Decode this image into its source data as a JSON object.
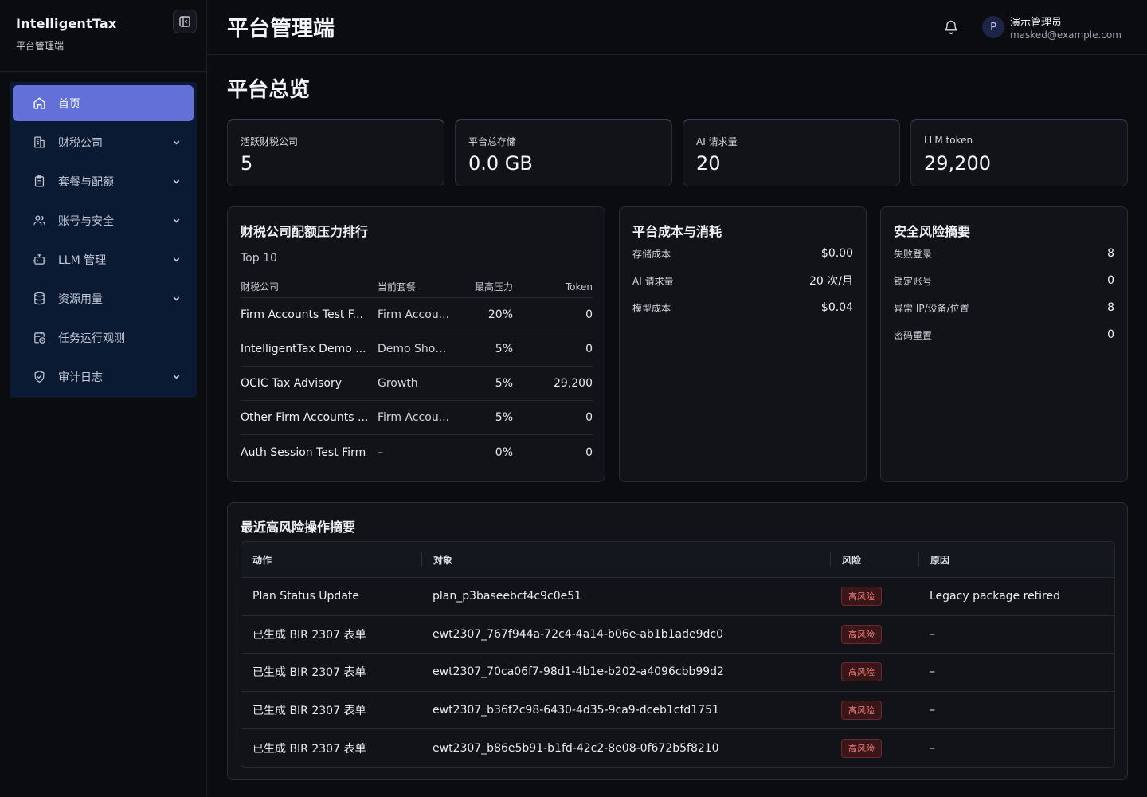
{
  "brand": {
    "title": "IntelligentTax",
    "subtitle": "平台管理端"
  },
  "sidebar": {
    "items": [
      {
        "label": "首页",
        "icon": "home-icon",
        "active": true,
        "expandable": false
      },
      {
        "label": "财税公司",
        "icon": "building-icon",
        "active": false,
        "expandable": true
      },
      {
        "label": "套餐与配额",
        "icon": "clipboard-icon",
        "active": false,
        "expandable": true
      },
      {
        "label": "账号与安全",
        "icon": "users-icon",
        "active": false,
        "expandable": true
      },
      {
        "label": "LLM 管理",
        "icon": "bot-icon",
        "active": false,
        "expandable": true
      },
      {
        "label": "资源用量",
        "icon": "database-icon",
        "active": false,
        "expandable": true
      },
      {
        "label": "任务运行观测",
        "icon": "calendar-clock-icon",
        "active": false,
        "expandable": false
      },
      {
        "label": "审计日志",
        "icon": "shield-check-icon",
        "active": false,
        "expandable": true
      }
    ]
  },
  "header": {
    "title": "平台管理端",
    "user": {
      "initial": "P",
      "name": "演示管理员",
      "email": "masked@example.com"
    }
  },
  "page": {
    "title": "平台总览"
  },
  "stats": [
    {
      "label": "活跃财税公司",
      "value": "5"
    },
    {
      "label": "平台总存储",
      "value": "0.0 GB"
    },
    {
      "label": "AI 请求量",
      "value": "20"
    },
    {
      "label": "LLM token",
      "value": "29,200"
    }
  ],
  "ranking": {
    "title": "财税公司配额压力排行",
    "subtitle": "Top 10",
    "columns": [
      "财税公司",
      "当前套餐",
      "最高压力",
      "Token"
    ],
    "rows": [
      [
        "Firm Accounts Test F...",
        "Firm Accou...",
        "20%",
        "0"
      ],
      [
        "IntelligentTax Demo ...",
        "Demo Show...",
        "5%",
        "0"
      ],
      [
        "OCIC Tax Advisory",
        "Growth",
        "5%",
        "29,200"
      ],
      [
        "Other Firm Accounts ...",
        "Firm Accou...",
        "5%",
        "0"
      ],
      [
        "Auth Session Test Firm",
        "–",
        "0%",
        "0"
      ]
    ]
  },
  "cost": {
    "title": "平台成本与消耗",
    "items": [
      {
        "label": "存储成本",
        "value": "$0.00"
      },
      {
        "label": "AI 请求量",
        "value": "20 次/月"
      },
      {
        "label": "模型成本",
        "value": "$0.04"
      }
    ]
  },
  "security": {
    "title": "安全风险摘要",
    "items": [
      {
        "label": "失败登录",
        "value": "8"
      },
      {
        "label": "锁定账号",
        "value": "0"
      },
      {
        "label": "异常 IP/设备/位置",
        "value": "8"
      },
      {
        "label": "密码重置",
        "value": "0"
      }
    ]
  },
  "risk_ops": {
    "title": "最近高风险操作摘要",
    "columns": [
      "动作",
      "对象",
      "风险",
      "原因"
    ],
    "rows": [
      [
        "Plan Status Update",
        "plan_p3baseebcf4c9c0e51",
        "高风险",
        "Legacy package retired"
      ],
      [
        "已生成 BIR 2307 表单",
        "ewt2307_767f944a-72c4-4a14-b06e-ab1b1ade9dc0",
        "高风险",
        "–"
      ],
      [
        "已生成 BIR 2307 表单",
        "ewt2307_70ca06f7-98d1-4b1e-b202-a4096cbb99d2",
        "高风险",
        "–"
      ],
      [
        "已生成 BIR 2307 表单",
        "ewt2307_b36f2c98-6430-4d35-9ca9-dceb1cfd1751",
        "高风险",
        "–"
      ],
      [
        "已生成 BIR 2307 表单",
        "ewt2307_b86e5b91-b1fd-42c2-8e08-0f672b5f8210",
        "高风险",
        "–"
      ]
    ]
  },
  "colors": {
    "accent": "#6270d8",
    "danger": "#f07c7c",
    "background": "#0b0c10",
    "nav_bg": "#0a1a33"
  }
}
